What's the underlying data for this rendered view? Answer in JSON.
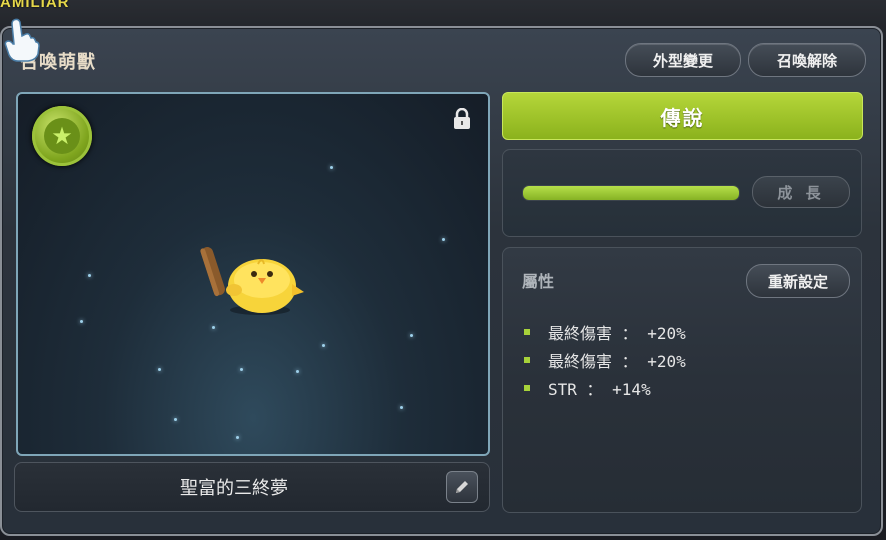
{
  "top_tag": "AMILIAR",
  "window": {
    "title": "召喚萌獸"
  },
  "header_buttons": {
    "change_look": "外型變更",
    "release": "召喚解除"
  },
  "familiar": {
    "grade": "傳說",
    "name": "聖富的三終夢",
    "locked": true,
    "growth_progress": 1.0,
    "grow_label": "成 長"
  },
  "attributes": {
    "title": "屬性",
    "reset_label": "重新設定",
    "lines": [
      {
        "label": "最終傷害 ： +20%"
      },
      {
        "label": "最終傷害 ： +20%"
      },
      {
        "label": "STR ： +14%"
      }
    ]
  },
  "colors": {
    "accent_green": "#9cc22a",
    "panel_bg": "#2c333c"
  },
  "icons": [
    "star-badge-icon",
    "lock-icon",
    "pencil-icon",
    "hand-cursor-icon"
  ]
}
